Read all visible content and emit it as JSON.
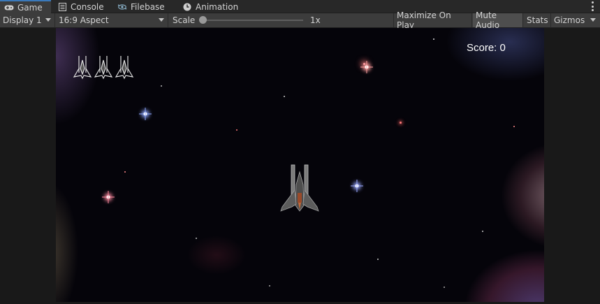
{
  "tabs": [
    {
      "label": "Game",
      "icon": "gamepad-icon"
    },
    {
      "label": "Console",
      "icon": "console-icon"
    },
    {
      "label": "Filebase",
      "icon": "filebase-icon"
    },
    {
      "label": "Animation",
      "icon": "clock-icon"
    }
  ],
  "toolbar": {
    "display": "Display 1",
    "aspect": "16:9 Aspect",
    "scale_label": "Scale",
    "scale_value": "1x",
    "maximize": "Maximize On Play",
    "mute": "Mute Audio",
    "stats": "Stats",
    "gizmos": "Gizmos"
  },
  "game": {
    "score_text": "Score: 0",
    "lives": 3
  },
  "colors": {
    "tab_bar": "#282828",
    "toolbar": "#3c3c3c",
    "active_tab_accent": "#3a79bb",
    "viewport_bg": "#05040a"
  }
}
